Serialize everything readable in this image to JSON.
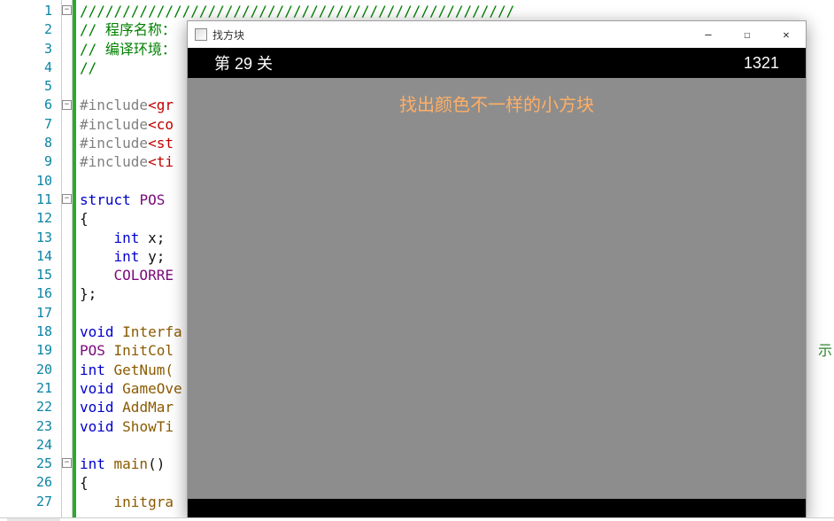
{
  "editor": {
    "line_count": 27,
    "fold_markers": [
      {
        "line": 1,
        "glyph": "-"
      },
      {
        "line": 6,
        "glyph": "-"
      },
      {
        "line": 11,
        "glyph": "-"
      },
      {
        "line": 25,
        "glyph": "-"
      }
    ],
    "lines": {
      "l1": "///////////////////////////////////////////////////",
      "l2a": "// ",
      "l2b": "程序名称：",
      "l3a": "// ",
      "l3b": "编译环境：",
      "l4": "//",
      "l6a": "#include",
      "l6b": "<gr",
      "l7a": "#include",
      "l7b": "<co",
      "l8a": "#include",
      "l8b": "<st",
      "l9a": "#include",
      "l9b": "<ti",
      "l11a": "struct ",
      "l11b": "POS",
      "l12": "{",
      "l13a": "    int ",
      "l13b": "x;",
      "l14a": "    int ",
      "l14b": "y;",
      "l15": "    COLORRE",
      "l16": "};",
      "l18a": "void ",
      "l18b": "Interfa",
      "l19a": "POS ",
      "l19b": "InitCol",
      "l19tail": "示",
      "l20a": "int ",
      "l20b": "GetNum(",
      "l21a": "void ",
      "l21b": "GameOve",
      "l22a": "void ",
      "l22b": "AddMar",
      "l23a": "void ",
      "l23b": "ShowTi",
      "l25a": "int ",
      "l25b": "main",
      "l25c": "()",
      "l26": "{",
      "l27": "    initgra"
    }
  },
  "game": {
    "window_title": "找方块",
    "level_label": "第 29 关",
    "score": "1321",
    "instruction": "找出颜色不一样的小方块"
  },
  "sysbuttons": {
    "min": "—",
    "max": "☐",
    "close": "✕"
  }
}
